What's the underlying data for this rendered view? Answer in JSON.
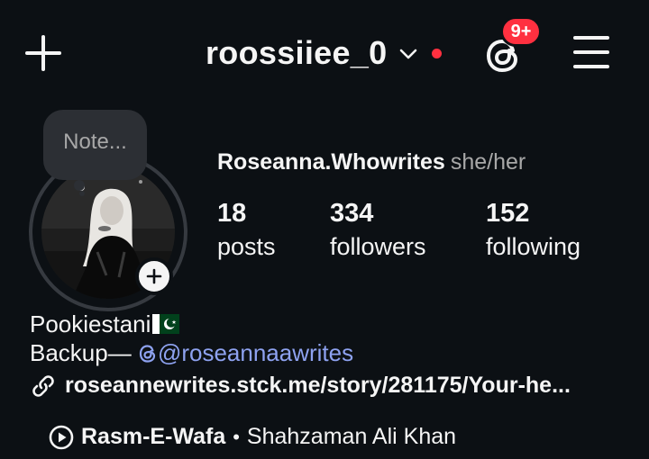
{
  "header": {
    "username": "roossiiee_0",
    "notification_badge": "9+",
    "icons": {
      "create": "plus-icon",
      "account_switch": "chevron-down-icon",
      "threads": "threads-icon",
      "menu": "hamburger-menu-icon"
    },
    "colors": {
      "badge": "#ff3040",
      "dot": "#ff3040"
    }
  },
  "note": {
    "placeholder": "Note..."
  },
  "profile": {
    "display_name": "Roseanna.Whowrites",
    "pronouns": "she/her",
    "stats": [
      {
        "value": "18",
        "label": "posts"
      },
      {
        "value": "334",
        "label": "followers"
      },
      {
        "value": "152",
        "label": "following"
      }
    ]
  },
  "bio": {
    "line1": "Pookiestani",
    "line1_emoji": "pakistan-flag",
    "line2_prefix": "Backup— ",
    "mention": "@roseannaawrites",
    "link": "roseannewrites.stck.me/story/281175/Your-he..."
  },
  "music": {
    "song": "Rasm-E-Wafa",
    "separator": "•",
    "artist": "Shahzaman Ali Khan"
  },
  "colors": {
    "background": "#0c1014",
    "text": "#f5f5f5",
    "muted": "#a8a8a8",
    "mention": "#8ea2f0"
  }
}
